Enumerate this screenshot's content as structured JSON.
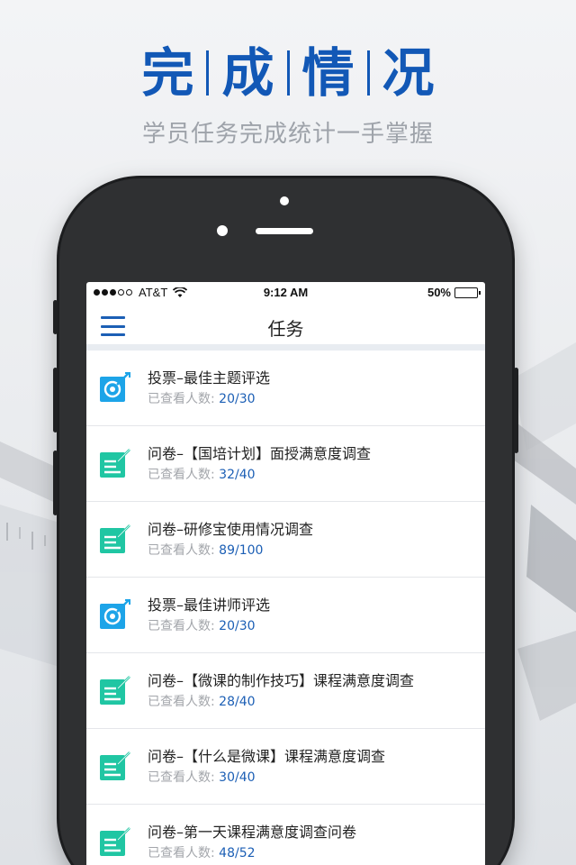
{
  "hero": {
    "title_chars": [
      "完",
      "成",
      "情",
      "况"
    ],
    "subtitle": "学员任务完成统计一手掌握"
  },
  "status_bar": {
    "carrier": "AT&T",
    "time": "9:12 AM",
    "battery": "50%",
    "battery_level": 0.5
  },
  "nav": {
    "title": "任务"
  },
  "tasks": [
    {
      "type": "vote-icon",
      "title": "投票–最佳主题评选",
      "label": "已查看人数:",
      "count": "20/30"
    },
    {
      "type": "survey-icon",
      "title": "问卷–【国培计划】面授满意度调查",
      "label": "已查看人数:",
      "count": "32/40"
    },
    {
      "type": "survey-icon",
      "title": "问卷–研修宝使用情况调查",
      "label": "已查看人数:",
      "count": "89/100"
    },
    {
      "type": "vote-icon",
      "title": "投票–最佳讲师评选",
      "label": "已查看人数:",
      "count": "20/30"
    },
    {
      "type": "survey-icon",
      "title": "问卷–【微课的制作技巧】课程满意度调查",
      "label": "已查看人数:",
      "count": "28/40"
    },
    {
      "type": "survey-icon",
      "title": "问卷–【什么是微课】课程满意度调查",
      "label": "已查看人数:",
      "count": "30/40"
    },
    {
      "type": "survey-icon",
      "title": "问卷–第一天课程满意度调查问卷",
      "label": "已查看人数:",
      "count": "48/52"
    }
  ],
  "colors": {
    "accent": "#1c5fb5",
    "hero_title": "#1258b6",
    "vote_icon": "#1da4e8",
    "survey_icon": "#20c6a3",
    "muted": "#a3a6ab"
  }
}
